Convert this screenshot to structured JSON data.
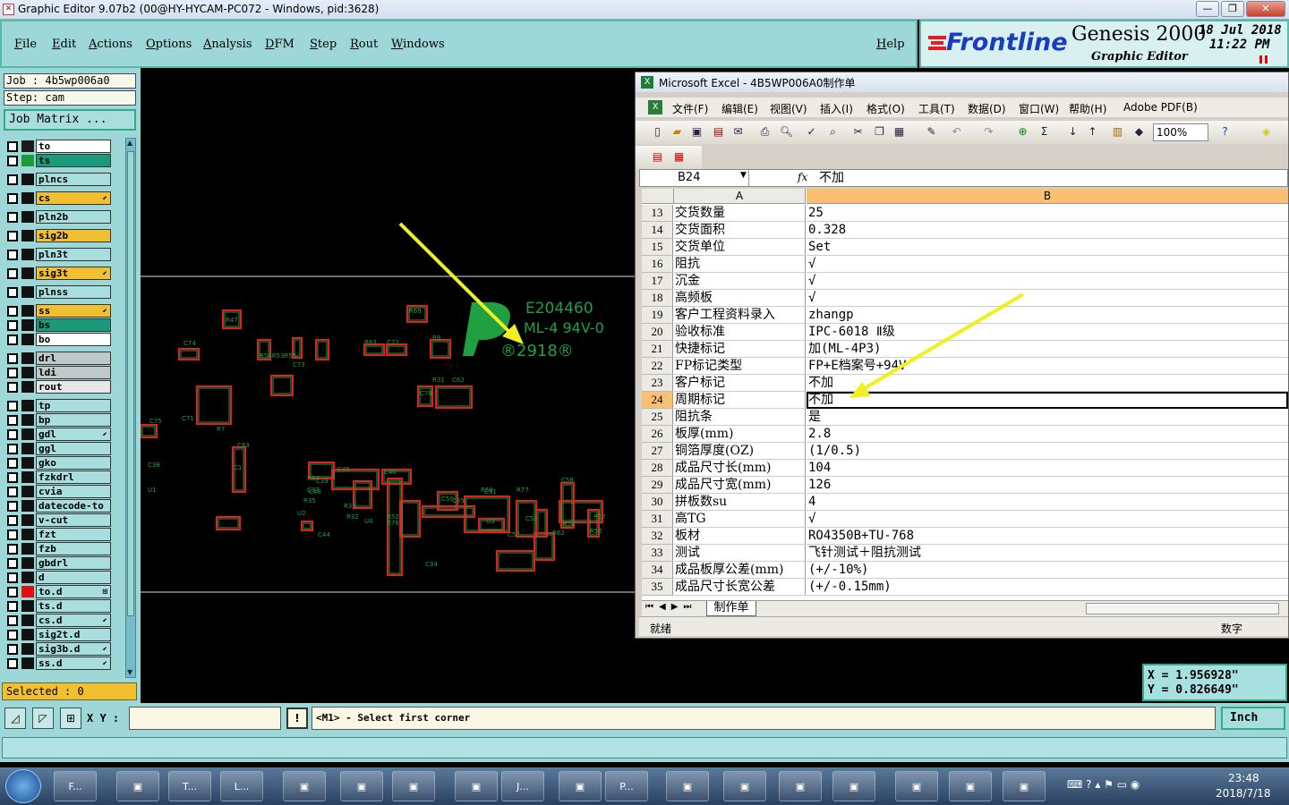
{
  "window": {
    "title": "Graphic Editor 9.07b2 (00@HY-HYCAM-PC072 - Windows, pid:3628)",
    "buttons": [
      "—",
      "❐",
      "✕"
    ]
  },
  "menu": {
    "items": [
      "File",
      "Edit",
      "Actions",
      "Options",
      "Analysis",
      "DFM",
      "Step",
      "Rout",
      "Windows"
    ],
    "help": "Help"
  },
  "logo": {
    "brand": "Frontline",
    "product": "Genesis 2000",
    "subtitle": "Graphic Editor",
    "date": "18 Jul 2018",
    "time": "11:22 PM"
  },
  "job": {
    "job_label": "Job : 4b5wp006a0",
    "step_label": "Step: cam",
    "matrix_button": "Job Matrix ..."
  },
  "layers": [
    {
      "name": "to",
      "bg": "#ffffff",
      "sw": "#1a1a1a",
      "mark": ""
    },
    {
      "name": "ts",
      "bg": "#1a9a7a",
      "sw": "#1a9a3a",
      "mark": ""
    },
    {
      "name": "plncs",
      "bg": "#a8dede",
      "sw": "#111",
      "mark": ""
    },
    {
      "name": "cs",
      "bg": "#f0c030",
      "sw": "#111",
      "mark": "⬋"
    },
    {
      "name": "pln2b",
      "bg": "#a8dede",
      "sw": "#111",
      "mark": ""
    },
    {
      "name": "sig2b",
      "bg": "#f0c030",
      "sw": "#111",
      "mark": ""
    },
    {
      "name": "pln3t",
      "bg": "#a8dede",
      "sw": "#111",
      "mark": ""
    },
    {
      "name": "sig3t",
      "bg": "#f0c030",
      "sw": "#111",
      "mark": "⬋"
    },
    {
      "name": "plnss",
      "bg": "#a8dede",
      "sw": "#111",
      "mark": ""
    },
    {
      "name": "ss",
      "bg": "#f0c030",
      "sw": "#111",
      "mark": "⬋"
    },
    {
      "name": "bs",
      "bg": "#1a9a7a",
      "sw": "#111",
      "mark": ""
    },
    {
      "name": "bo",
      "bg": "#ffffff",
      "sw": "#111",
      "mark": ""
    },
    {
      "name": "drl",
      "bg": "#c0c8c8",
      "sw": "#111",
      "mark": ""
    },
    {
      "name": "ldi",
      "bg": "#c0c8c8",
      "sw": "#111",
      "mark": ""
    },
    {
      "name": "rout",
      "bg": "#e8e8e8",
      "sw": "#111",
      "mark": ""
    },
    {
      "name": "tp",
      "bg": "#a8dede",
      "sw": "#111",
      "mark": ""
    },
    {
      "name": "bp",
      "bg": "#a8dede",
      "sw": "#111",
      "mark": ""
    },
    {
      "name": "gdl",
      "bg": "#a8dede",
      "sw": "#111",
      "mark": "⬋"
    },
    {
      "name": "ggl",
      "bg": "#a8dede",
      "sw": "#111",
      "mark": ""
    },
    {
      "name": "gko",
      "bg": "#a8dede",
      "sw": "#111",
      "mark": ""
    },
    {
      "name": "fzkdrl",
      "bg": "#a8dede",
      "sw": "#111",
      "mark": ""
    },
    {
      "name": "cvia",
      "bg": "#a8dede",
      "sw": "#111",
      "mark": ""
    },
    {
      "name": "datecode-to",
      "bg": "#a8dede",
      "sw": "#111",
      "mark": ""
    },
    {
      "name": "v-cut",
      "bg": "#a8dede",
      "sw": "#111",
      "mark": ""
    },
    {
      "name": "fzt",
      "bg": "#a8dede",
      "sw": "#111",
      "mark": ""
    },
    {
      "name": "fzb",
      "bg": "#a8dede",
      "sw": "#111",
      "mark": ""
    },
    {
      "name": "gbdrl",
      "bg": "#a8dede",
      "sw": "#111",
      "mark": ""
    },
    {
      "name": "d",
      "bg": "#a8dede",
      "sw": "#111",
      "mark": ""
    },
    {
      "name": "to.d",
      "bg": "#a8dede",
      "sw": "#e01010",
      "mark": "⊞"
    },
    {
      "name": "ts.d",
      "bg": "#a8dede",
      "sw": "#111",
      "mark": ""
    },
    {
      "name": "cs.d",
      "bg": "#a8dede",
      "sw": "#111",
      "mark": "⬋"
    },
    {
      "name": "sig2t.d",
      "bg": "#a8dede",
      "sw": "#111",
      "mark": ""
    },
    {
      "name": "sig3b.d",
      "bg": "#a8dede",
      "sw": "#111",
      "mark": "⬋"
    },
    {
      "name": "ss.d",
      "bg": "#a8dede",
      "sw": "#111",
      "mark": "⬋"
    }
  ],
  "selected": "Selected : 0",
  "board": {
    "marking": [
      "E204460",
      "ML-4 94V-0",
      "®2918®"
    ],
    "refs": [
      "R47",
      "C74",
      "R54R53R55",
      "C73",
      "R63",
      "C72",
      "R8",
      "R69",
      "C70",
      "C71",
      "R7",
      "R31",
      "C62",
      "C75",
      "C63",
      "C1",
      "C45",
      "R34",
      "C40",
      "R35",
      "C48",
      "R32",
      "R33",
      "C39",
      "C37",
      "C38",
      "U1",
      "U2",
      "C44",
      "U4",
      "R52",
      "C34",
      "U3",
      "R78",
      "C50",
      "C35",
      "R77",
      "R59",
      "C58",
      "R76",
      "R57",
      "R56",
      "R62",
      "C51",
      "C57",
      "C52"
    ]
  },
  "excel": {
    "title": "Microsoft Excel - 4B5WP006A0制作单",
    "menu": [
      "文件(F)",
      "编辑(E)",
      "视图(V)",
      "插入(I)",
      "格式(O)",
      "工具(T)",
      "数据(D)",
      "窗口(W)",
      "帮助(H)",
      "Adobe PDF(B)"
    ],
    "zoom": "100%",
    "namebox": "B24",
    "fx": "fx",
    "formula": "不加",
    "col_a": "A",
    "col_b": "B",
    "rows": [
      {
        "n": "13",
        "a": "交货数量",
        "b": "25"
      },
      {
        "n": "14",
        "a": "交货面积",
        "b": "0.328"
      },
      {
        "n": "15",
        "a": "交货单位",
        "b": "Set"
      },
      {
        "n": "16",
        "a": "阻抗",
        "b": "√"
      },
      {
        "n": "17",
        "a": "沉金",
        "b": "√"
      },
      {
        "n": "18",
        "a": "高频板",
        "b": "√"
      },
      {
        "n": "19",
        "a": "客户工程资料录入",
        "b": "zhangp"
      },
      {
        "n": "20",
        "a": "验收标准",
        "b": "IPC-6018 Ⅱ级"
      },
      {
        "n": "21",
        "a": "快捷标记",
        "b": "加(ML-4P3)"
      },
      {
        "n": "22",
        "a": "FP标记类型",
        "b": "FP+E档案号+94V"
      },
      {
        "n": "23",
        "a": "客户标记",
        "b": "不加"
      },
      {
        "n": "24",
        "a": "周期标记",
        "b": "不加"
      },
      {
        "n": "25",
        "a": "阻抗条",
        "b": "是"
      },
      {
        "n": "26",
        "a": "板厚(mm)",
        "b": "2.8"
      },
      {
        "n": "27",
        "a": "铜箔厚度(OZ)",
        "b": "(1/0.5)"
      },
      {
        "n": "28",
        "a": "成品尺寸长(mm)",
        "b": "104"
      },
      {
        "n": "29",
        "a": "成品尺寸宽(mm)",
        "b": "126"
      },
      {
        "n": "30",
        "a": "拼板数su",
        "b": "4"
      },
      {
        "n": "31",
        "a": "高TG",
        "b": "√"
      },
      {
        "n": "32",
        "a": "板材",
        "b": "RO4350B+TU-768"
      },
      {
        "n": "33",
        "a": "测试",
        "b": "飞针测试＋阻抗测试"
      },
      {
        "n": "34",
        "a": "成品板厚公差(mm)",
        "b": "(+/-10%)"
      },
      {
        "n": "35",
        "a": "成品尺寸长宽公差",
        "b": "(+/-0.15mm)"
      }
    ],
    "sheet_tab": "制作单",
    "status_left": "就绪",
    "status_right": "数字"
  },
  "coords": {
    "x": "X = 1.956928\"",
    "y": "Y = 0.826649\""
  },
  "cmd": {
    "xy_label": "X Y :",
    "xy_value": "",
    "prompt": "<M1> - Select first corner",
    "units": "Inch"
  },
  "taskbar": {
    "items": [
      "F...",
      "",
      "T...",
      "L...",
      "",
      "",
      "",
      "",
      "J...",
      "",
      "P...",
      "",
      "",
      "",
      "",
      "",
      "",
      ""
    ],
    "clock_time": "23:48",
    "clock_date": "2018/7/18"
  },
  "colors": {
    "teal": "#9ed7d7",
    "pad_red": "#e02020",
    "pad_green": "#20a040",
    "arrow": "#f0f020"
  }
}
